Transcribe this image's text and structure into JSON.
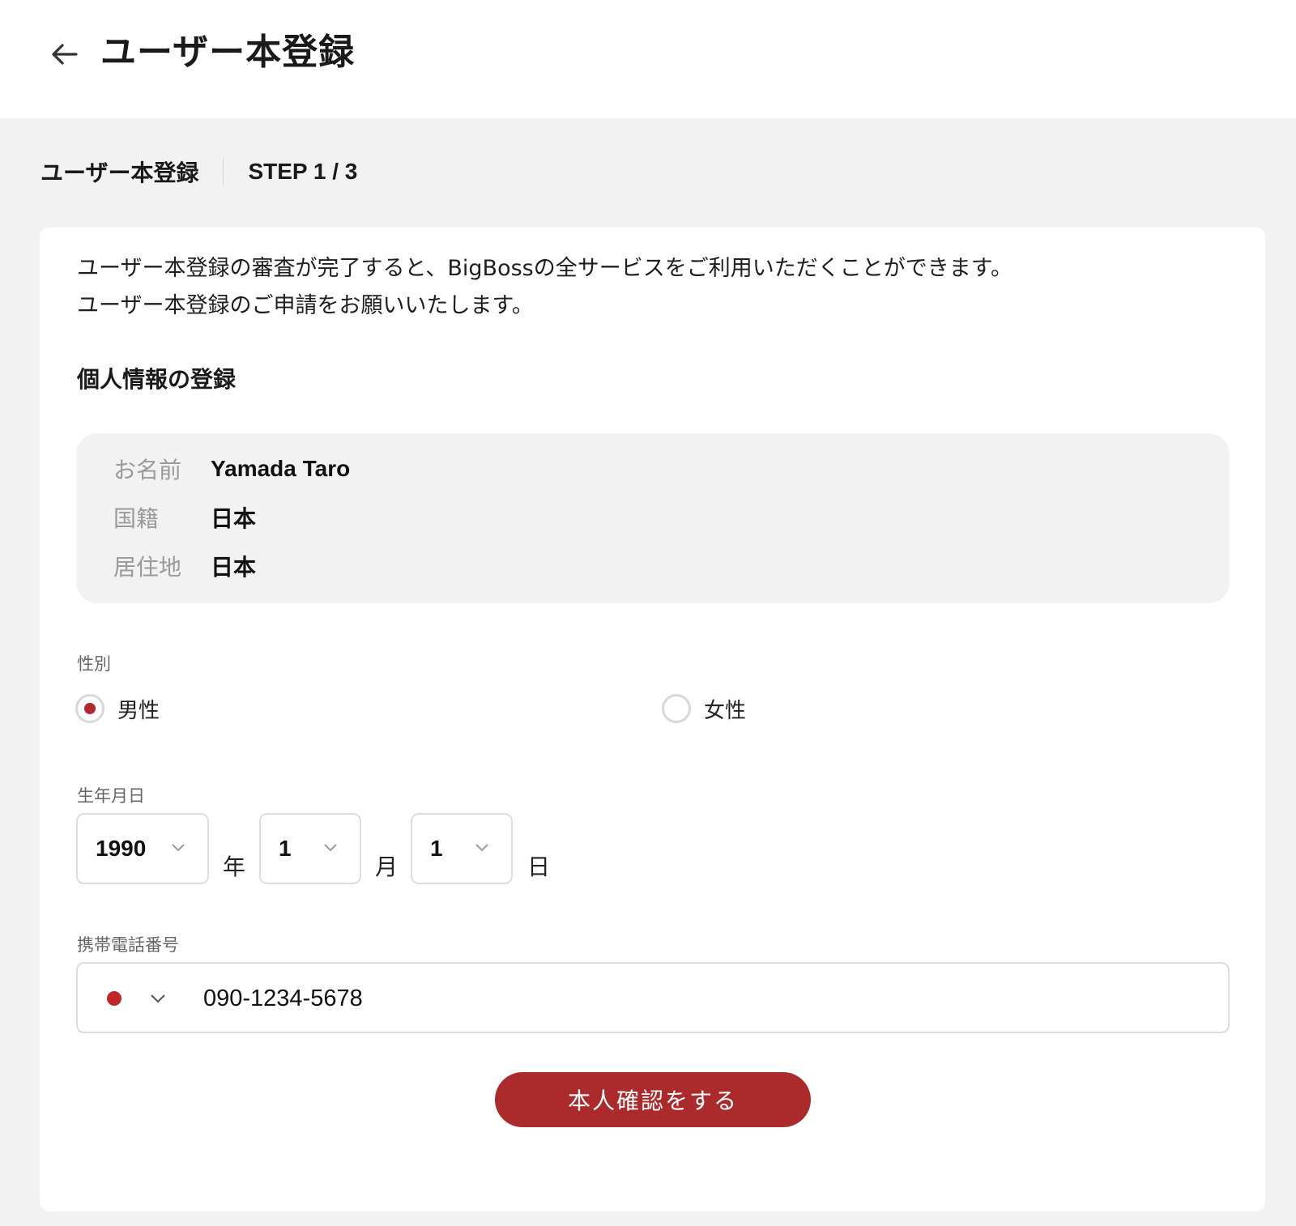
{
  "header": {
    "title": "ユーザー本登録",
    "back_icon": "arrow-left-icon"
  },
  "step": {
    "name": "ユーザー本登録",
    "count": "STEP 1 / 3"
  },
  "intro": {
    "line1": "ユーザー本登録の審査が完了すると、BigBossの全サービスをご利用いただくことができます。",
    "line2": "ユーザー本登録のご申請をお願いいたします。"
  },
  "personal": {
    "section_title": "個人情報の登録",
    "rows": [
      {
        "label": "お名前",
        "value": "Yamada Taro"
      },
      {
        "label": "国籍",
        "value": "日本"
      },
      {
        "label": "居住地",
        "value": "日本"
      }
    ]
  },
  "gender": {
    "label": "性別",
    "options": [
      {
        "label": "男性",
        "selected": true
      },
      {
        "label": "女性",
        "selected": false
      }
    ]
  },
  "birthdate": {
    "label": "生年月日",
    "year": "1990",
    "year_unit": "年",
    "month": "1",
    "month_unit": "月",
    "day": "1",
    "day_unit": "日"
  },
  "phone": {
    "label": "携帯電話番号",
    "value": "090-1234-5678",
    "country_flag_color": "#c0272d"
  },
  "submit": {
    "label": "本人確認をする"
  },
  "colors": {
    "accent": "#ab2a2b",
    "page_background": "#f2f2f2",
    "card_background": "#ffffff"
  }
}
